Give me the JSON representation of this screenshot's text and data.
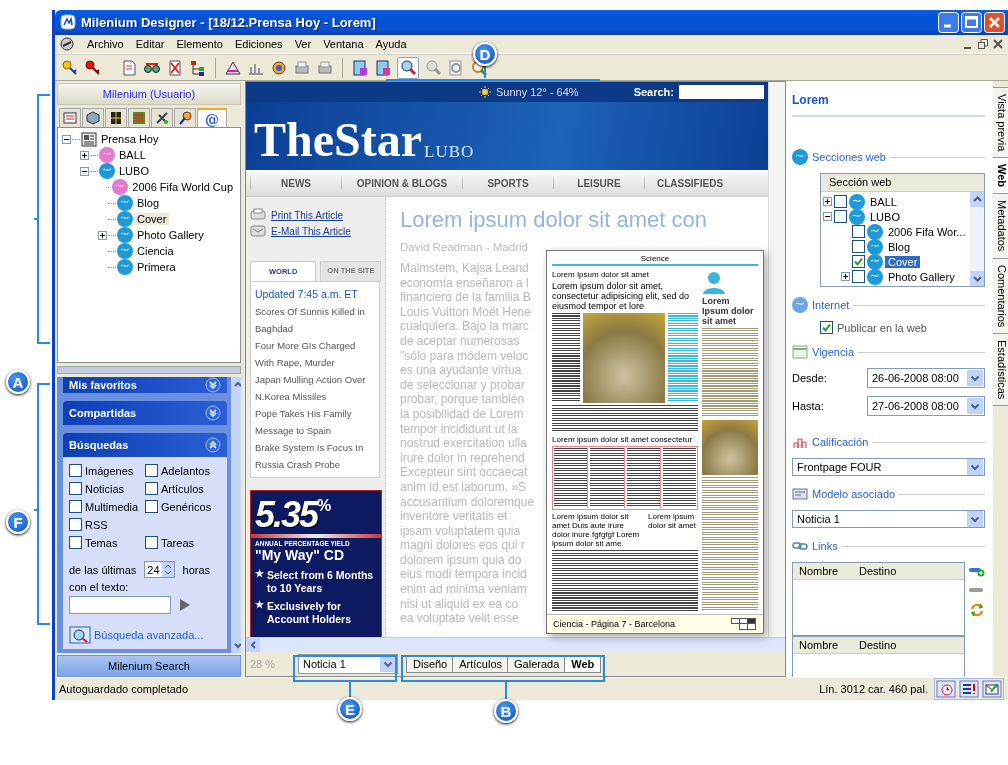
{
  "window": {
    "title": "Milenium Designer - [18/12.Prensa Hoy - Lorem]"
  },
  "menu": [
    "Archivo",
    "Editar",
    "Elemento",
    "Ediciones",
    "Ver",
    "Ventana",
    "Ayuda"
  ],
  "left_pane": {
    "title": "Milenium (Usuario)",
    "tabs": [
      {
        "selected": false
      },
      {
        "selected": false
      },
      {
        "selected": false
      },
      {
        "selected": false
      },
      {
        "selected": false
      },
      {
        "selected": false
      },
      {
        "label": "@",
        "selected": true
      }
    ],
    "tree": {
      "label": "Prensa Hoy",
      "expanded": true,
      "selected": false,
      "children": [
        {
          "label": "BALL",
          "expanded": false,
          "selected": false,
          "color": "#e27ad0"
        },
        {
          "label": "LUBO",
          "expanded": true,
          "selected": false,
          "color": "#1e9bd7",
          "children": [
            {
              "label": "2006 Fifa World Cup",
              "selected": false,
              "color": "#e27ad0"
            },
            {
              "label": "Blog",
              "selected": false,
              "color": "#1e9bd7"
            },
            {
              "label": "Cover",
              "selected": true,
              "color": "#1e9bd7"
            },
            {
              "label": "Photo Gallery",
              "expanded": false,
              "selected": false,
              "color": "#1e9bd7"
            },
            {
              "label": "Ciencia",
              "selected": false,
              "color": "#1e9bd7"
            },
            {
              "label": "Primera",
              "selected": false,
              "color": "#1e9bd7"
            }
          ]
        }
      ]
    }
  },
  "task_pane": {
    "groups": [
      {
        "title": "Mis favoritos",
        "expanded": false
      },
      {
        "title": "Compartidas",
        "expanded": false
      },
      {
        "title": "Búsquedas",
        "expanded": true
      }
    ],
    "checkbox_rows": [
      [
        {
          "label": "Imágenes",
          "checked": false
        },
        {
          "label": "Adelantos",
          "checked": false
        }
      ],
      [
        {
          "label": "Noticias",
          "checked": false
        },
        {
          "label": "Artículos",
          "checked": false
        }
      ],
      [
        {
          "label": "Multimedia",
          "checked": false
        },
        {
          "label": "Genéricos",
          "checked": false
        }
      ],
      [
        {
          "label": "RSS",
          "checked": false
        }
      ],
      [
        {
          "label": "Temas",
          "checked": false
        },
        {
          "label": "Tareas",
          "checked": false
        }
      ]
    ],
    "hours_label": "de las últimas",
    "hours": "24",
    "hours_unit": "horas",
    "text_label": "con el texto:",
    "advanced_link": "Búsqueda avanzada...",
    "footer": "Milenium Search"
  },
  "web_page": {
    "weather": "Sunny 12° - 64%",
    "search_label": "Search:",
    "logo": "TheStar",
    "logo_sub": "LUBO",
    "nav": [
      "NEWS",
      "OPINION & BLOGS",
      "SPORTS",
      "LEISURE",
      "CLASSIFIEDS"
    ],
    "tools": [
      "Print This Article",
      "E-Mail This Article"
    ],
    "news_tabs": [
      {
        "label": "WORLD",
        "selected": true
      },
      {
        "label": "ON THE SITE",
        "selected": false
      }
    ],
    "updated": "Updated 7:45 a.m. ET",
    "headlines": [
      "Scores Of Sunnis Killed in Baghdad",
      "Four More GIs Charged With Rape, Murder",
      "Japan Mulling Action Over N.Korea Missiles",
      "Pope Takes His Family Message to Spain",
      "Brake System Is Focus In Russia Crash Probe"
    ],
    "ad": {
      "rate": "5.35",
      "percent": "%",
      "yield": "ANNUAL PERCENTAGE YIELD",
      "product": "\"My Way\" CD",
      "points": [
        "Select from 6 Months to 10 Years",
        "Exclusively for Account Holders"
      ]
    },
    "article": {
      "title": "Lorem ipsum dolor sit amet con",
      "byline": "David Readman - Madrid",
      "lines": [
        "Malmstem, Kajsa Leand",
        "economía enseñaron a l",
        "financiero de la familia B",
        "Louis Vuitton Moët Hene",
        "cualquiera. Bajo la marc",
        "de aceptar numerosas",
        "\"sólo para módem veloc",
        "es una ayudante virtua",
        "de seleccionar y probar",
        "probar, porque también",
        "la posibilidad de Lorem",
        "tempor incididunt ut la",
        "nostrud exercitation ulla",
        "irure dolor in reprehend",
        "Excepteur sint occaecat",
        "anim id est laborum. »S",
        "accusantium doloremque",
        "inventore veritatis et",
        "ipsam voluptatem quia",
        "magni dolores eos qui r",
        "dolorem ipsum quia do",
        "eius modi tempora incid",
        "enim ad minima veniam",
        "nisi ut aliquid ex ea co",
        "ea voluptate velit esse"
      ]
    }
  },
  "doc_bar": {
    "zoom": "28 %",
    "model": "Noticia 1",
    "view_tabs": [
      {
        "label": "Diseño",
        "selected": false
      },
      {
        "label": "Artículos",
        "selected": false
      },
      {
        "label": "Galerada",
        "selected": false
      },
      {
        "label": "Web",
        "selected": true
      }
    ]
  },
  "page_preview": {
    "section": "Science",
    "kicker": "Lorem Ipsum dolor sit amet",
    "headline": "Lorem ipsum dolor sit amet, consectetur adipisicing elit, sed do eiusmod tempor et lore",
    "side_headline": "Lorem Ipsum dolor sit amet",
    "subhead": "Lorem ipsum dolor sit amet consectetur",
    "caption_left": "Lorem ipsum dolor sit amet Duis aute irure dolor inure fgfgfgf Lorem ipsum dolor sit ame",
    "caption_right": "Lorem ipsum dolor sit amet",
    "footer": "Ciencia - Página 7 - Barcelona"
  },
  "properties": {
    "title": "Lorem",
    "web_sections": {
      "heading": "Secciones web",
      "column": "Sección web",
      "rows": [
        {
          "label": "BALL",
          "expanded": false,
          "checked": false,
          "selected": false,
          "children": []
        },
        {
          "label": "LUBO",
          "expanded": true,
          "checked": false,
          "selected": false,
          "children": [
            {
              "label": "2006 Fifa Wor...",
              "checked": false,
              "selected": false
            },
            {
              "label": "Blog",
              "checked": false,
              "selected": false
            },
            {
              "label": "Cover",
              "checked": true,
              "selected": true
            },
            {
              "label": "Photo Gallery",
              "expanded": false,
              "checked": false,
              "selected": false
            }
          ]
        }
      ]
    },
    "internet": {
      "heading": "Internet",
      "publish_label": "Publicar en la web",
      "publish": true
    },
    "validity": {
      "heading": "Vigencia",
      "from_label": "Desde:",
      "from": "26-06-2008 08:00",
      "to_label": "Hasta:",
      "to": "27-06-2008 08:00"
    },
    "rating": {
      "heading": "Calificación",
      "value": "Frontpage FOUR"
    },
    "model": {
      "heading": "Modelo asociado",
      "value": "Noticia 1"
    },
    "links": {
      "heading": "Links",
      "tables": [
        [
          "Nombre",
          "Destino"
        ],
        [
          "Nombre",
          "Destino"
        ]
      ]
    }
  },
  "side_tabs": [
    {
      "label": "Vista previa",
      "selected": false
    },
    {
      "label": "Web",
      "selected": true
    },
    {
      "label": "Metadatos",
      "selected": false
    },
    {
      "label": "Comentarios",
      "selected": false
    },
    {
      "label": "Estadísticas",
      "selected": false
    }
  ],
  "status_bar": {
    "message": "Autoguardado completado",
    "position": "Lín. 3012 car. 460 pal."
  },
  "callouts": [
    "A",
    "F",
    "D",
    "E",
    "B"
  ]
}
